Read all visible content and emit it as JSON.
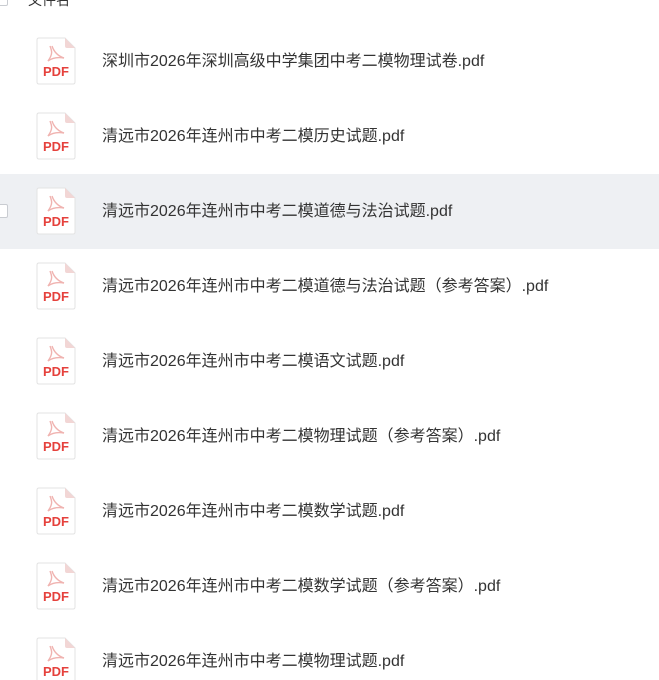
{
  "header": {
    "column_label": "文件名"
  },
  "files": [
    {
      "name": "深圳市2026年深圳高级中学集团中考二模物理试卷.pdf",
      "icon": "pdf-file-icon",
      "icon_text": "PDF",
      "selected": false
    },
    {
      "name": "清远市2026年连州市中考二模历史试题.pdf",
      "icon": "pdf-file-icon",
      "icon_text": "PDF",
      "selected": false
    },
    {
      "name": "清远市2026年连州市中考二模道德与法治试题.pdf",
      "icon": "pdf-file-icon",
      "icon_text": "PDF",
      "selected": true
    },
    {
      "name": "清远市2026年连州市中考二模道德与法治试题（参考答案）.pdf",
      "icon": "pdf-file-icon",
      "icon_text": "PDF",
      "selected": false
    },
    {
      "name": "清远市2026年连州市中考二模语文试题.pdf",
      "icon": "pdf-file-icon",
      "icon_text": "PDF",
      "selected": false
    },
    {
      "name": "清远市2026年连州市中考二模物理试题（参考答案）.pdf",
      "icon": "pdf-file-icon",
      "icon_text": "PDF",
      "selected": false
    },
    {
      "name": "清远市2026年连州市中考二模数学试题.pdf",
      "icon": "pdf-file-icon",
      "icon_text": "PDF",
      "selected": false
    },
    {
      "name": "清远市2026年连州市中考二模数学试题（参考答案）.pdf",
      "icon": "pdf-file-icon",
      "icon_text": "PDF",
      "selected": false
    },
    {
      "name": "清远市2026年连州市中考二模物理试题.pdf",
      "icon": "pdf-file-icon",
      "icon_text": "PDF",
      "selected": false
    }
  ],
  "colors": {
    "pdf_red": "#e5413c",
    "selected_row_bg": "#eef0f3",
    "text": "#333333"
  }
}
